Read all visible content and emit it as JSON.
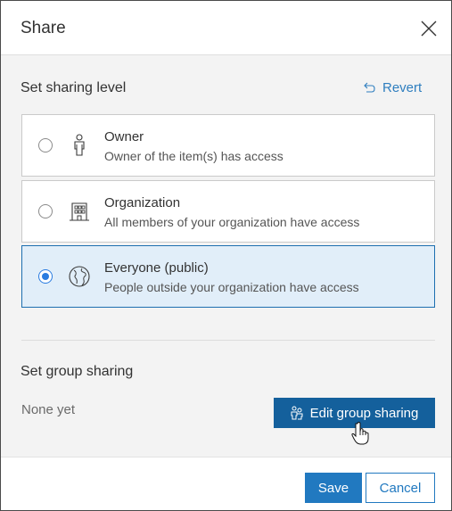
{
  "dialog": {
    "title": "Share",
    "close_icon": "close-x-icon"
  },
  "sharing_level": {
    "label": "Set sharing level",
    "revert_label": "Revert",
    "revert_icon": "undo-arrow-icon",
    "selected": "everyone",
    "options": [
      {
        "id": "owner",
        "title": "Owner",
        "description": "Owner of the item(s) has access",
        "icon": "person-icon",
        "selected": false
      },
      {
        "id": "organization",
        "title": "Organization",
        "description": "All members of your organization have access",
        "icon": "building-icon",
        "selected": false
      },
      {
        "id": "everyone",
        "title": "Everyone (public)",
        "description": "People outside your organization have access",
        "icon": "globe-icon",
        "selected": true
      }
    ]
  },
  "group_sharing": {
    "label": "Set group sharing",
    "status": "None yet",
    "edit_button_label": "Edit group sharing",
    "edit_button_icon": "users-icon"
  },
  "footer": {
    "save_label": "Save",
    "cancel_label": "Cancel"
  },
  "colors": {
    "primary": "#2179c0",
    "primary_dark": "#14609c",
    "selected_bg": "#e1eef9",
    "link": "#2e7ebf"
  }
}
